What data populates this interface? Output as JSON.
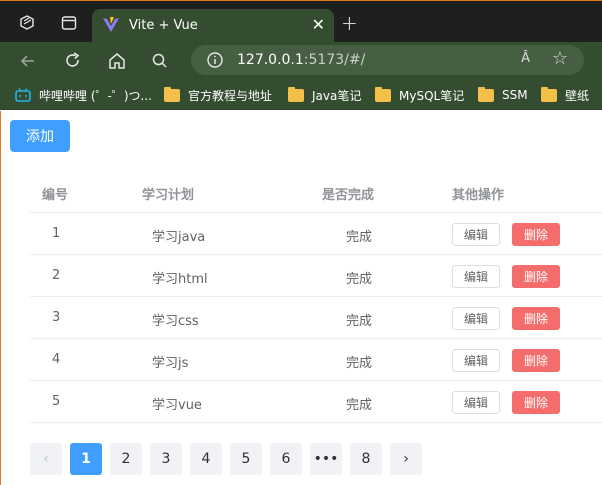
{
  "browser": {
    "tab_title": "Vite + Vue",
    "tab_close": "✕",
    "new_tab": "+",
    "url_host": "127.0.0.1",
    "url_rest": ":5173/#/",
    "read_aloud": "Ȃ",
    "favorite": "☆"
  },
  "bookmarks": [
    {
      "label": "哔哩哔哩 (゜-゜)つ...",
      "icon": "bilibili-icon"
    },
    {
      "label": "官方教程与地址",
      "icon": "folder-icon"
    },
    {
      "label": "Java笔记",
      "icon": "folder-icon"
    },
    {
      "label": "MySQL笔记",
      "icon": "folder-icon"
    },
    {
      "label": "SSM",
      "icon": "folder-icon"
    },
    {
      "label": "壁纸",
      "icon": "folder-icon"
    }
  ],
  "page": {
    "add_button": "添加",
    "columns": [
      "编号",
      "学习计划",
      "是否完成",
      "其他操作"
    ],
    "rows": [
      {
        "id": "1",
        "plan": "学习java",
        "done": "完成"
      },
      {
        "id": "2",
        "plan": "学习html",
        "done": "完成"
      },
      {
        "id": "3",
        "plan": "学习css",
        "done": "完成"
      },
      {
        "id": "4",
        "plan": "学习js",
        "done": "完成"
      },
      {
        "id": "5",
        "plan": "学习vue",
        "done": "完成"
      }
    ],
    "edit_label": "编辑",
    "delete_label": "删除",
    "pagination": {
      "prev": "‹",
      "pages": [
        "1",
        "2",
        "3",
        "4",
        "5",
        "6",
        "•••",
        "8"
      ],
      "current": "1",
      "next": "›"
    }
  },
  "colors": {
    "primary": "#409eff",
    "danger": "#f56c6c",
    "browser_theme": "#344d30"
  }
}
